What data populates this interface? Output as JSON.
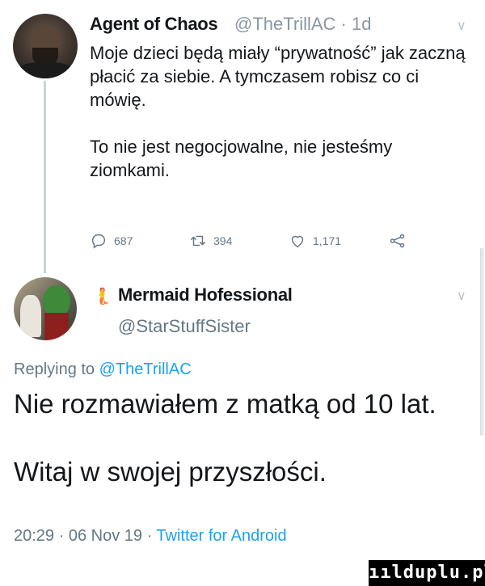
{
  "tweet": {
    "author_name": "Agent of Chaos",
    "handle_time": "@TheTrillAC · 1d",
    "text": "Moje dzieci będą miały “prywatność” jak zaczną płacić za siebie. A tymczasem robisz co ci mówię.\n\nTo nie jest negocjowalne, nie jesteśmy ziomkami.",
    "replies": "687",
    "retweets": "394",
    "likes": "1,171"
  },
  "reply": {
    "author_emoji": "🧜",
    "author_name": "Mermaid Hofessional",
    "handle": "@StarStuffSister",
    "replying_prefix": "Replying to",
    "replying_to": "@TheTrillAC",
    "text": "Nie rozmawiałem z matką od 10 lat.\n\nWitaj w swojej przyszłości.",
    "timestamp": "20:29 · 06 Nov 19 ·",
    "source": "Twitter for Android"
  },
  "watermark": "ıılduplu.pl",
  "colors": {
    "text": "#14171a",
    "muted": "#657786",
    "link": "#1da1f2",
    "thread_line": "#c9d2d9"
  },
  "icons": [
    "reply-icon",
    "retweet-icon",
    "like-icon",
    "share-icon",
    "chevron-down-icon"
  ]
}
